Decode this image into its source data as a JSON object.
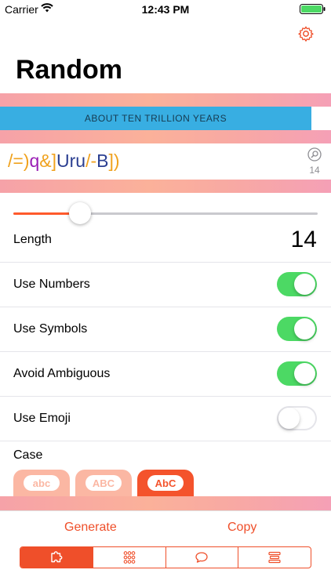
{
  "status_bar": {
    "carrier": "Carrier",
    "time": "12:43 PM"
  },
  "header": {
    "title": "Random",
    "settings_icon": "gear-icon"
  },
  "strength": {
    "label": "ABOUT TEN TRILLION YEARS",
    "fill_fraction": 0.94,
    "color": "#38aee2"
  },
  "password": {
    "segments": [
      {
        "text": "/=)",
        "color": "#f0a21e"
      },
      {
        "text": "q",
        "color": "#9b1fb5"
      },
      {
        "text": "&]",
        "color": "#f0a21e"
      },
      {
        "text": "Uru",
        "color": "#2b3f91"
      },
      {
        "text": "/-",
        "color": "#f0a21e"
      },
      {
        "text": "B",
        "color": "#2b3f91"
      },
      {
        "text": "])",
        "color": "#f0a21e"
      }
    ],
    "character_count": "14",
    "zoom_icon": "magnify-icon"
  },
  "slider": {
    "value": 14,
    "fill_fraction": 0.22,
    "accent": "#ff5a2c"
  },
  "options": {
    "length_label": "Length",
    "length_value": "14",
    "use_numbers": {
      "label": "Use Numbers",
      "on": true
    },
    "use_symbols": {
      "label": "Use Symbols",
      "on": true
    },
    "avoid_ambiguous": {
      "label": "Avoid Ambiguous",
      "on": true
    },
    "use_emoji": {
      "label": "Use Emoji",
      "on": false
    }
  },
  "case": {
    "label": "Case",
    "options": [
      {
        "text": "abc",
        "selected": false
      },
      {
        "text": "ABC",
        "selected": false
      },
      {
        "text": "AbC",
        "selected": true
      }
    ]
  },
  "actions": {
    "generate": "Generate",
    "copy": "Copy"
  },
  "generator_tabs": [
    {
      "icon": "puzzle-icon",
      "selected": true
    },
    {
      "icon": "grid-dots-icon",
      "selected": false
    },
    {
      "icon": "speech-bubble-icon",
      "selected": false
    },
    {
      "icon": "text-lines-icon",
      "selected": false
    }
  ],
  "colors": {
    "accent": "#ef4f2a",
    "toggle_on": "#4cd964"
  }
}
